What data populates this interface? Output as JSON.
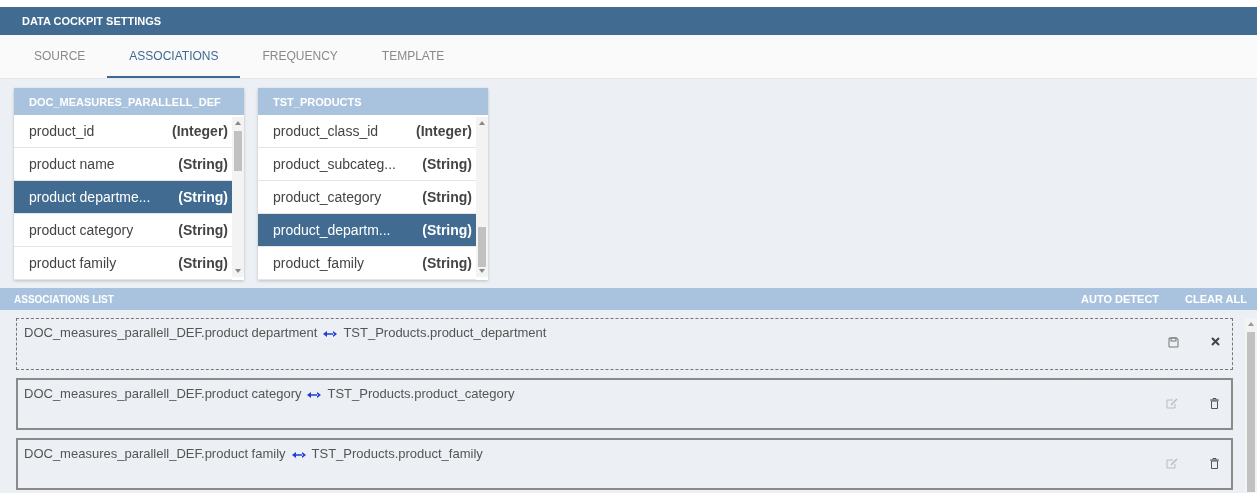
{
  "window": {
    "title": "DATA COCKPIT SETTINGS"
  },
  "tabs": [
    {
      "label": "SOURCE",
      "selected": false
    },
    {
      "label": "ASSOCIATIONS",
      "selected": true
    },
    {
      "label": "FREQUENCY",
      "selected": false
    },
    {
      "label": "TEMPLATE",
      "selected": false
    }
  ],
  "tables": [
    {
      "title": "DOC_MEASURES_PARALLELL_DEF",
      "rows": [
        {
          "name": "product_id",
          "type": "(Integer)",
          "selected": false
        },
        {
          "name": "product name",
          "type": "(String)",
          "selected": false
        },
        {
          "name": "product departme...",
          "type": "(String)",
          "selected": true
        },
        {
          "name": "product category",
          "type": "(String)",
          "selected": false
        },
        {
          "name": "product family",
          "type": "(String)",
          "selected": false
        }
      ]
    },
    {
      "title": "TST_PRODUCTS",
      "rows": [
        {
          "name": "product_class_id",
          "type": "(Integer)",
          "selected": false
        },
        {
          "name": "product_subcateg...",
          "type": "(String)",
          "selected": false
        },
        {
          "name": "product_category",
          "type": "(String)",
          "selected": false
        },
        {
          "name": "product_departm...",
          "type": "(String)",
          "selected": true
        },
        {
          "name": "product_family",
          "type": "(String)",
          "selected": false
        }
      ]
    }
  ],
  "associations": {
    "title": "ASSOCIATIONS LIST",
    "actions": [
      "AUTO DETECT",
      "CLEAR ALL"
    ],
    "items": [
      {
        "kind": "editing",
        "left": "DOC_measures_parallell_DEF.product department",
        "right": "TST_Products.product_department"
      },
      {
        "kind": "saved",
        "left": "DOC_measures_parallell_DEF.product category",
        "right": "TST_Products.product_category"
      },
      {
        "kind": "saved",
        "left": "DOC_measures_parallell_DEF.product family",
        "right": "TST_Products.product_family"
      }
    ]
  }
}
